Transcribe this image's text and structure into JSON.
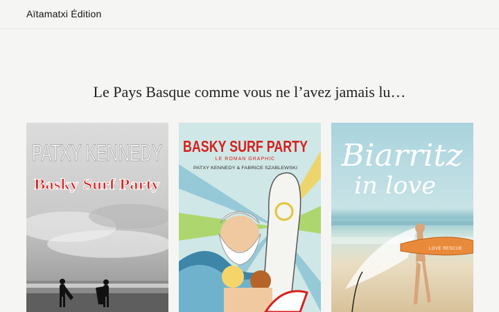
{
  "header": {
    "site_title": "Aïtamatxi Édition"
  },
  "main": {
    "tagline": "Le Pays Basque comme vous ne l’avez jamais lu…"
  },
  "books": [
    {
      "author": "PATXY KENNEDY",
      "title": "Basky Surf Party"
    },
    {
      "title": "BASKY SURF PARTY",
      "subtitle": "LE ROMAN GRAPHIC",
      "authors": "PATXY KENNEDY & FABRICE SZABLEWSKI"
    },
    {
      "title_line1": "Biarritz",
      "title_line2": "in love",
      "board_text": "LOVE RESCUE"
    }
  ],
  "colors": {
    "background": "#f5f5f3",
    "title_red": "#d6201e",
    "sky_blue": "#b9dbe3"
  }
}
